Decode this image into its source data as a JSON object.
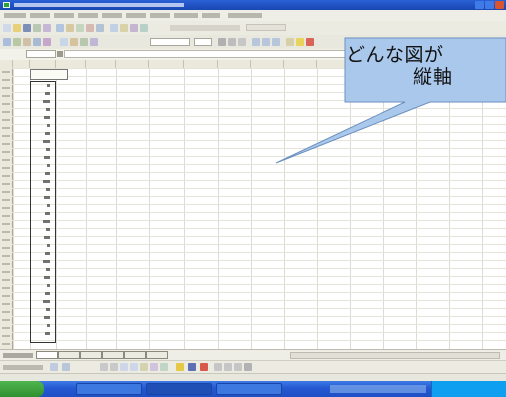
{
  "callout": {
    "line1": "どんな図が",
    "line2": "縦軸"
  },
  "colors": {
    "titlebar": "#2458d1",
    "taskbar": "#2458d1",
    "start_button": "#2e8f2e",
    "callout_fill": "#a9c8ec",
    "callout_stroke": "#6b8fbf"
  }
}
